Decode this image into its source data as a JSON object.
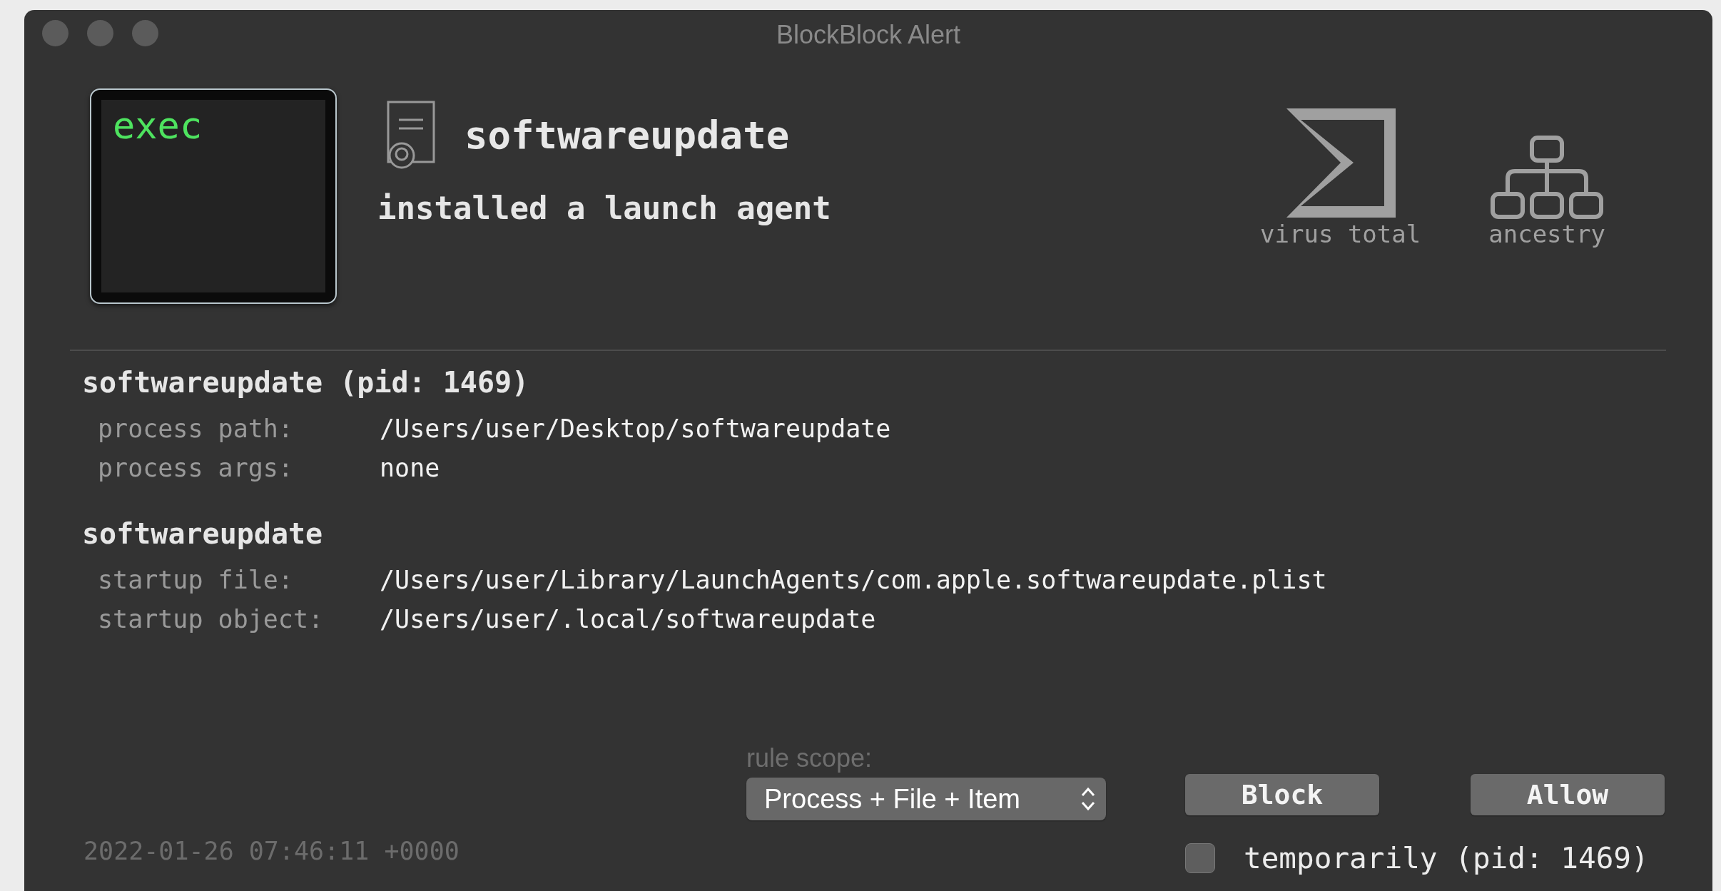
{
  "window": {
    "title": "BlockBlock Alert"
  },
  "alert": {
    "badge": "exec",
    "item": "softwareupdate",
    "action": "installed a launch agent"
  },
  "tools": [
    {
      "kind": "virustotal",
      "label": "virus total"
    },
    {
      "kind": "ancestry",
      "label": "ancestry"
    }
  ],
  "sections": [
    {
      "title": "softwareupdate (pid: 1469)",
      "rows": [
        {
          "label": "process path:",
          "value": "/Users/user/Desktop/softwareupdate"
        },
        {
          "label": "process args:",
          "value": "none"
        }
      ]
    },
    {
      "title": "softwareupdate",
      "rows": [
        {
          "label": "startup file:",
          "value": "/Users/user/Library/LaunchAgents/com.apple.softwareupdate.plist"
        },
        {
          "label": "startup object:",
          "value": "/Users/user/.local/softwareupdate"
        }
      ]
    }
  ],
  "rule_scope": {
    "label": "rule scope:",
    "value": "Process + File + Item"
  },
  "buttons": [
    "Block",
    "Allow"
  ],
  "timestamp": "2022-01-26 07:46:11 +0000",
  "temporarily": {
    "label": "temporarily (pid: 1469)",
    "checked": false
  }
}
